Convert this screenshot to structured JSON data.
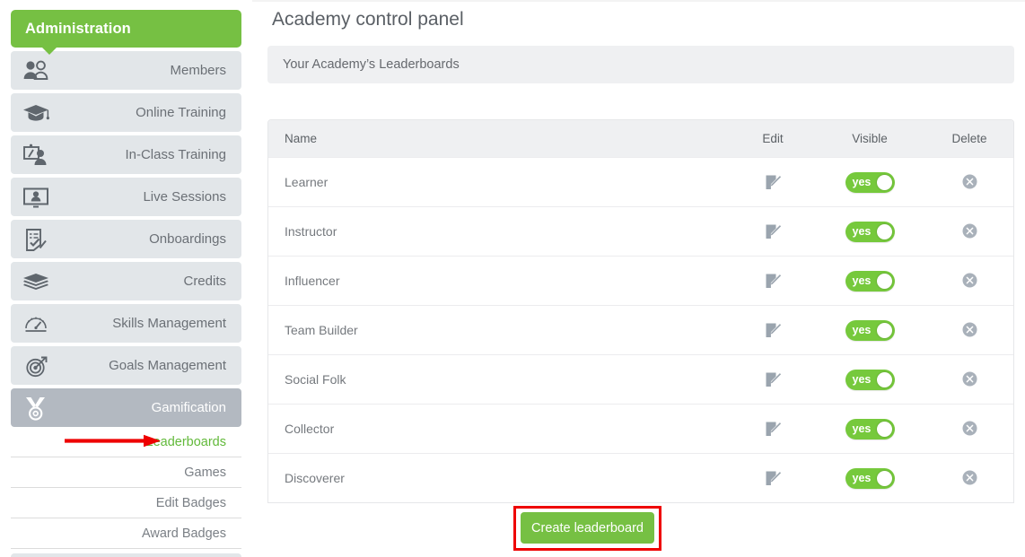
{
  "sidebar": {
    "header": {
      "label": "Administration"
    },
    "items": [
      {
        "label": "Members",
        "icon": "two-people-icon",
        "state": "normal"
      },
      {
        "label": "Online Training",
        "icon": "graduation-cap-icon",
        "state": "normal"
      },
      {
        "label": "In-Class Training",
        "icon": "whiteboard-person-icon",
        "state": "normal"
      },
      {
        "label": "Live Sessions",
        "icon": "monitor-person-icon",
        "state": "normal"
      },
      {
        "label": "Onboardings",
        "icon": "checklist-pencil-icon",
        "state": "normal"
      },
      {
        "label": "Credits",
        "icon": "layers-icon",
        "state": "normal"
      },
      {
        "label": "Skills Management",
        "icon": "gauge-icon",
        "state": "normal"
      },
      {
        "label": "Goals Management",
        "icon": "target-arrow-icon",
        "state": "normal"
      },
      {
        "label": "Gamification",
        "icon": "medal-icon",
        "state": "active"
      }
    ],
    "sub_items": [
      {
        "label": "Leaderboards",
        "state": "selected"
      },
      {
        "label": "Games",
        "state": "normal"
      },
      {
        "label": "Edit Badges",
        "state": "normal"
      },
      {
        "label": "Award Badges",
        "state": "normal"
      }
    ]
  },
  "main": {
    "page_title": "Academy control panel",
    "subtitle": "Your Academy’s Leaderboards",
    "table": {
      "headers": {
        "name": "Name",
        "edit": "Edit",
        "visible": "Visible",
        "delete": "Delete"
      },
      "rows": [
        {
          "name": "Learner",
          "visible_label": "yes",
          "visible": true
        },
        {
          "name": "Instructor",
          "visible_label": "yes",
          "visible": true
        },
        {
          "name": "Influencer",
          "visible_label": "yes",
          "visible": true
        },
        {
          "name": "Team Builder",
          "visible_label": "yes",
          "visible": true
        },
        {
          "name": "Social Folk",
          "visible_label": "yes",
          "visible": true
        },
        {
          "name": "Collector",
          "visible_label": "yes",
          "visible": true
        },
        {
          "name": "Discoverer",
          "visible_label": "yes",
          "visible": true
        }
      ]
    },
    "create_button": {
      "label": "Create leaderboard"
    }
  },
  "annotations": {
    "arrow_color": "#ee0000",
    "highlight_box_color": "#ee0000"
  },
  "colors": {
    "brand_green": "#76c043",
    "toggle_green": "#76c93c",
    "nav_grey": "#e2e6e9",
    "nav_active_grey": "#b3b9c1",
    "panel_grey": "#eff0f2",
    "text_grey": "#6b7076"
  }
}
